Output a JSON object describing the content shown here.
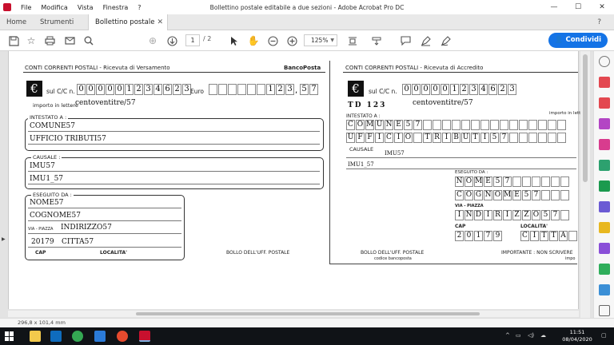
{
  "window": {
    "title": "Bollettino postale editabile a due sezioni - Adobe Acrobat Pro DC",
    "menu": [
      "File",
      "Modifica",
      "Vista",
      "Finestra",
      "?"
    ],
    "controls": [
      "—",
      "☐",
      "✕"
    ]
  },
  "tabs": {
    "home": "Home",
    "tools": "Strumenti",
    "document": "Bollettino postale e...",
    "close": "✕",
    "help": "?"
  },
  "toolbar": {
    "page_current": "1",
    "page_total": "/ 2",
    "zoom": "125%",
    "share_label": "Condividi"
  },
  "slip_left": {
    "header": "CONTI CORRENTI POSTALI - Ricevuta di Versamento",
    "brand": "BancoPosta",
    "account_label": "sul C/C n.",
    "account_digits": [
      "0",
      "0",
      "0",
      "0",
      "0",
      "1",
      "2",
      "3",
      "4",
      "6",
      "2",
      "3"
    ],
    "euro_label": "Euro",
    "amount_int_digits": [
      "1",
      "2",
      "3"
    ],
    "amount_sep": ",",
    "amount_dec_digits": [
      "5",
      "7"
    ],
    "amount_words_label": "importo in lettere",
    "amount_words": "centoventitre/57",
    "holder_label": "INTESTATO A :",
    "holder_line1": "COMUNE57",
    "holder_line2": "UFFICIO TRIBUTI57",
    "reason_label": "CAUSALE :",
    "reason_line1": "IMU57",
    "reason_line2": "IMU1_57",
    "payer_label": "ESEGUITO DA :",
    "payer_name": "NOME57",
    "payer_surname": "COGNOME57",
    "street_label": "VIA - PIAZZA",
    "street_value": "INDIRIZZO57",
    "postcode_value": "20179",
    "city_value": "CITTA57",
    "cap_label": "CAP",
    "locality_label": "LOCALITA'",
    "stamp_label": "BOLLO DELL'UFF. POSTALE"
  },
  "slip_right": {
    "header": "CONTI CORRENTI POSTALI - Ricevuta di Accredito",
    "account_label": "sul C/C n.",
    "account_digits": [
      "0",
      "0",
      "0",
      "0",
      "0",
      "1",
      "2",
      "3",
      "4",
      "6",
      "2",
      "3"
    ],
    "td_label": "TD 123",
    "amount_words": "centoventitre/57",
    "amount_words_label": "importo in lettere",
    "holder_label": "INTESTATO A :",
    "holder_line1": [
      "C",
      "O",
      "M",
      "U",
      "N",
      "E",
      "5",
      "7"
    ],
    "holder_line2": [
      "U",
      "F",
      "F",
      "I",
      "C",
      "I",
      "O",
      "",
      "T",
      "R",
      "I",
      "B",
      "U",
      "T",
      "I",
      "5",
      "7"
    ],
    "reason_label": "CAUSALE",
    "reason_line1": "IMU57",
    "reason_line2": "IMU1_57",
    "payer_label": "ESEGUITO DA :",
    "payer_name": [
      "N",
      "O",
      "M",
      "E",
      "5",
      "7"
    ],
    "payer_surname": [
      "C",
      "O",
      "G",
      "N",
      "O",
      "M",
      "E",
      "5",
      "7"
    ],
    "street_label": "VIA - PIAZZA",
    "street_value": [
      "I",
      "N",
      "D",
      "I",
      "R",
      "I",
      "Z",
      "Z",
      "O",
      "5",
      "7"
    ],
    "cap_label": "CAP",
    "postcode": [
      "2",
      "0",
      "1",
      "7",
      "9"
    ],
    "locality_label": "LOCALITA'",
    "city": [
      "C",
      "I",
      "T",
      "T",
      "A"
    ],
    "stamp_label": "BOLLO DELL'UFF. POSTALE",
    "stamp_sub": "codice bancoposta",
    "important_label": "IMPORTANTE : NON SCRIVERE",
    "important_sub": "impo"
  },
  "status": {
    "page_size": "296,8 x 101,4 mm"
  },
  "taskbar": {
    "time": "11:51",
    "date": "08/04/2020"
  }
}
